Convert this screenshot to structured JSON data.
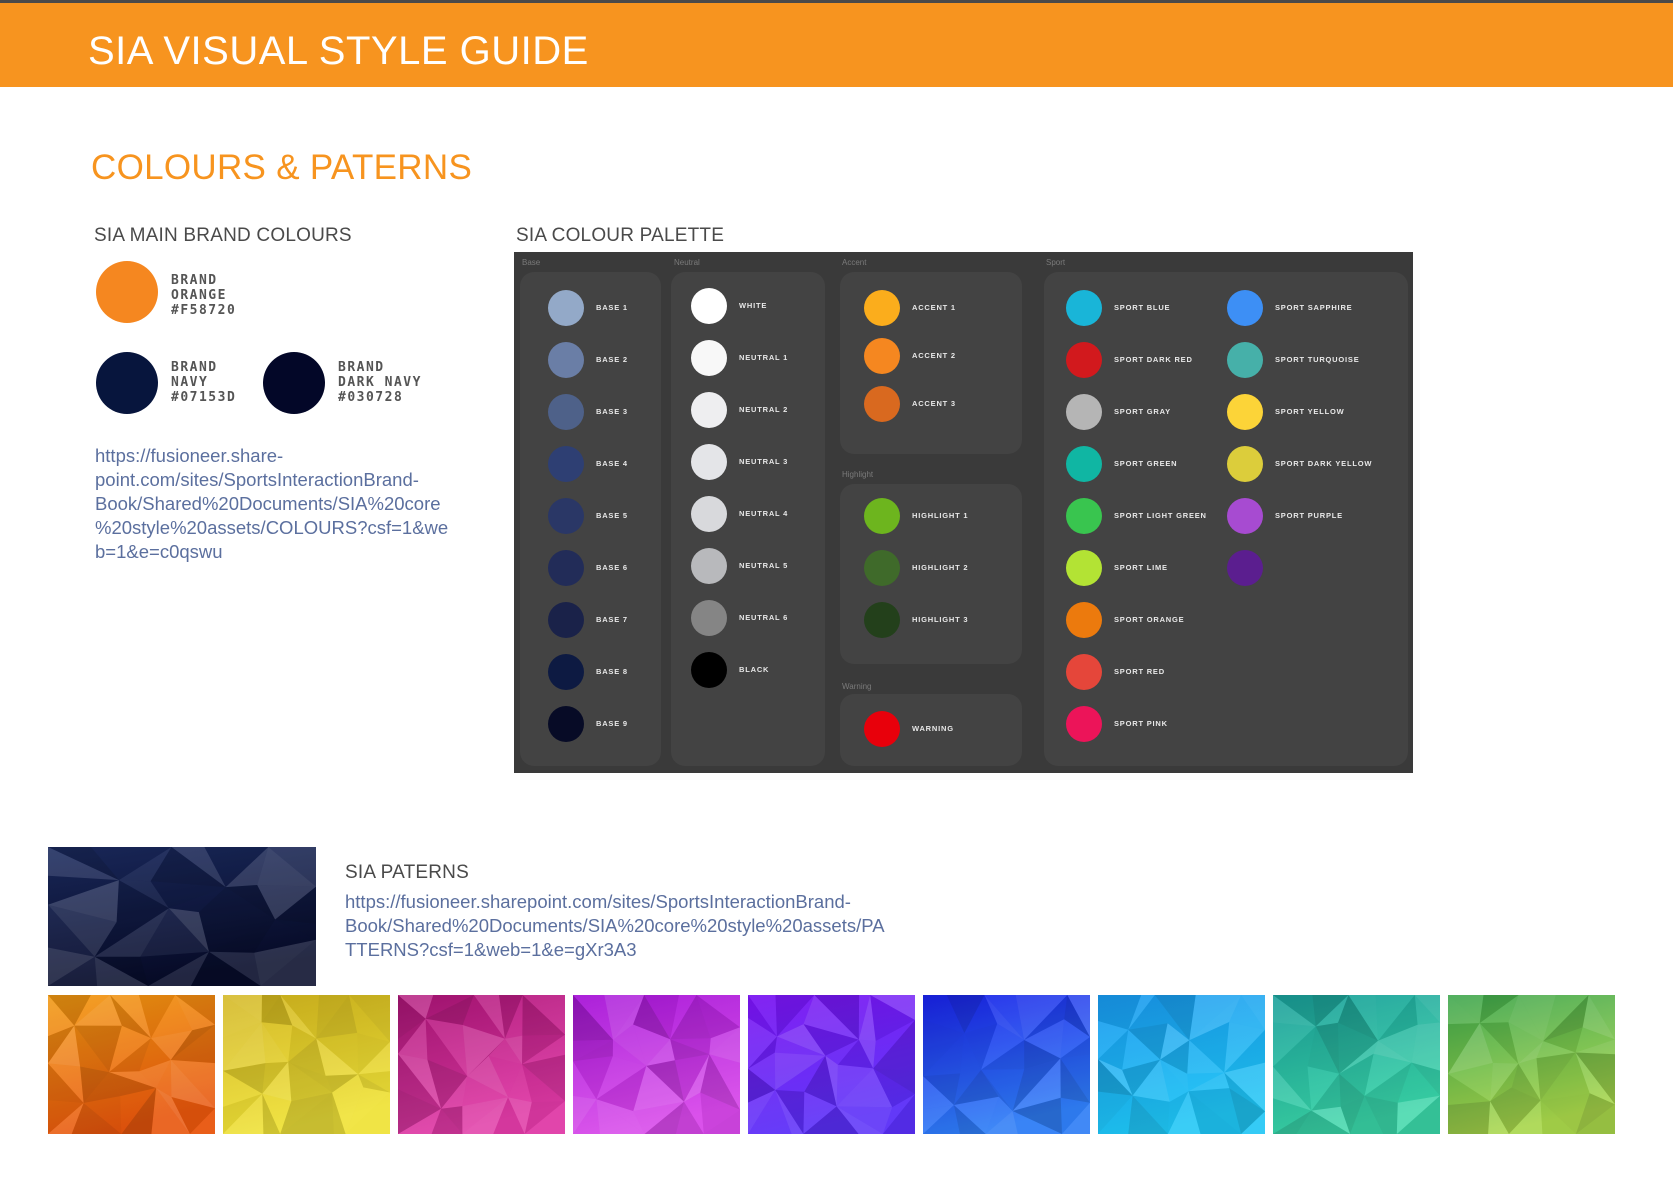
{
  "header": {
    "title": "SIA VISUAL STYLE GUIDE"
  },
  "section": {
    "title": "COLOURS & PATERNS"
  },
  "brand": {
    "heading": "SIA MAIN BRAND COLOURS",
    "colors": [
      {
        "name1": "BRAND",
        "name2": "ORANGE",
        "hex": "#F58720",
        "color": "#F58720"
      },
      {
        "name1": "BRAND",
        "name2": "NAVY",
        "hex": "#07153D",
        "color": "#07153D"
      },
      {
        "name1": "BRAND",
        "name2": "DARK NAVY",
        "hex": "#030728",
        "color": "#030728"
      }
    ],
    "link_lines": [
      "https://fusioneer.share-",
      "point.com/sites/SportsInteractionBrand-",
      "Book/Shared%20Documents/SIA%20core",
      "%20style%20assets/COLOURS?csf=1&we",
      "b=1&e=c0qswu"
    ]
  },
  "palette": {
    "heading": "SIA COLOUR PALETTE",
    "groups": {
      "base": {
        "title": "Base",
        "items": [
          {
            "label": "BASE 1",
            "color": "#93a9c8"
          },
          {
            "label": "BASE 2",
            "color": "#6a7ea6"
          },
          {
            "label": "BASE 3",
            "color": "#4e6189"
          },
          {
            "label": "BASE 4",
            "color": "#2e3f73"
          },
          {
            "label": "BASE 5",
            "color": "#2a3766"
          },
          {
            "label": "BASE 6",
            "color": "#222c58"
          },
          {
            "label": "BASE 7",
            "color": "#1a2249"
          },
          {
            "label": "BASE 8",
            "color": "#0d1a42"
          },
          {
            "label": "BASE 9",
            "color": "#070b26"
          }
        ]
      },
      "neutral": {
        "title": "Neutral",
        "items": [
          {
            "label": "WHITE",
            "color": "#ffffff"
          },
          {
            "label": "NEUTRAL 1",
            "color": "#f8f8f8"
          },
          {
            "label": "NEUTRAL 2",
            "color": "#eeeef0"
          },
          {
            "label": "NEUTRAL 3",
            "color": "#e4e5e8"
          },
          {
            "label": "NEUTRAL 4",
            "color": "#d8d9dc"
          },
          {
            "label": "NEUTRAL 5",
            "color": "#b8b9bc"
          },
          {
            "label": "NEUTRAL 6",
            "color": "#858585"
          },
          {
            "label": "BLACK",
            "color": "#000000"
          }
        ]
      },
      "accent": {
        "title": "Accent",
        "items": [
          {
            "label": "ACCENT 1",
            "color": "#fbad1c"
          },
          {
            "label": "ACCENT 2",
            "color": "#f58720"
          },
          {
            "label": "ACCENT 3",
            "color": "#d9691f"
          }
        ]
      },
      "highlight": {
        "title": "Highlight",
        "items": [
          {
            "label": "HIGHLIGHT 1",
            "color": "#6db51e"
          },
          {
            "label": "HIGHLIGHT 2",
            "color": "#3f6a2a"
          },
          {
            "label": "HIGHLIGHT 3",
            "color": "#23401b"
          }
        ]
      },
      "warning": {
        "title": "Warning",
        "items": [
          {
            "label": "WARNING",
            "color": "#e8000b"
          }
        ]
      },
      "sport": {
        "title": "Sport",
        "col1": [
          {
            "label": "SPORT BLUE",
            "color": "#19b5d8"
          },
          {
            "label": "SPORT DARK RED",
            "color": "#d2191d"
          },
          {
            "label": "SPORT GRAY",
            "color": "#b5b5b5"
          },
          {
            "label": "SPORT GREEN",
            "color": "#10b6a3"
          },
          {
            "label": "SPORT LIGHT GREEN",
            "color": "#39c54f"
          },
          {
            "label": "SPORT LIME",
            "color": "#b3e334"
          },
          {
            "label": "SPORT ORANGE",
            "color": "#ec7a0d"
          },
          {
            "label": "SPORT RED",
            "color": "#e5463a"
          },
          {
            "label": "SPORT PINK",
            "color": "#ec1459"
          }
        ],
        "col2": [
          {
            "label": "SPORT SAPPHIRE",
            "color": "#3d8ff5"
          },
          {
            "label": "SPORT TURQUOISE",
            "color": "#46b0a9"
          },
          {
            "label": "SPORT YELLOW",
            "color": "#fcd438"
          },
          {
            "label": "SPORT DARK YELLOW",
            "color": "#dccd3b"
          },
          {
            "label": "SPORT PURPLE",
            "color": "#a74bd1"
          },
          {
            "label": "",
            "color": "#5b1e8f"
          }
        ]
      }
    }
  },
  "patterns": {
    "heading": "SIA PATERNS",
    "link_lines": [
      "https://fusioneer.sharepoint.com/sites/SportsInteractionBrand-",
      "Book/Shared%20Documents/SIA%20core%20style%20assets/PA",
      "TTERNS?csf=1&web=1&e=gXr3A3"
    ],
    "main": {
      "c1": "#1b2a5e",
      "c2": "#070c2a"
    },
    "tiles": [
      {
        "c1": "#f29a12",
        "c2": "#e8560d"
      },
      {
        "c1": "#d2b51c",
        "c2": "#f0e33a"
      },
      {
        "c1": "#b0157a",
        "c2": "#e03aa6"
      },
      {
        "c1": "#a716d8",
        "c2": "#d848ea"
      },
      {
        "c1": "#7a13f2",
        "c2": "#5a2ff8"
      },
      {
        "c1": "#1a22e8",
        "c2": "#2f7ef6"
      },
      {
        "c1": "#1898ee",
        "c2": "#1fc6f5"
      },
      {
        "c1": "#1a9f9a",
        "c2": "#3ad6a8"
      },
      {
        "c1": "#3aa44a",
        "c2": "#a8d64a"
      }
    ]
  }
}
